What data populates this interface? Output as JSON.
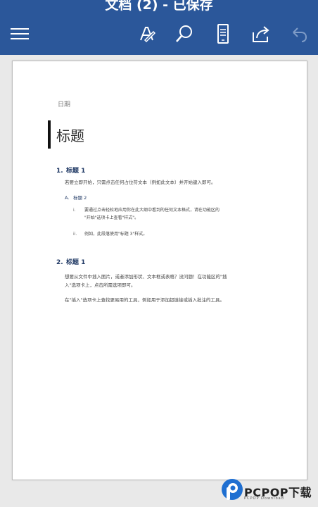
{
  "window": {
    "title": "文档 (2) - 已保存"
  },
  "toolbar": {
    "menu": "hamburger-icon",
    "edit": "pen-icon",
    "search": "search-icon",
    "view": "mobile-view-icon",
    "share": "share-icon",
    "undo": "undo-icon",
    "undo_disabled": true
  },
  "colors": {
    "brand": "#2b579a",
    "heading": "#1f3864"
  },
  "document": {
    "date": "日期",
    "title": "标题",
    "section1": {
      "num": "1.",
      "heading": "标题 1",
      "body": "若要立即开始，只需点击任何占位符文本（例如此文本）并开始键入即可。",
      "sub": {
        "num": "A.",
        "heading": "标题 2",
        "items": [
          {
            "num": "i.",
            "line1": "要通过点击轻松地应用你在此大纲中看到的任何文本格式，请在功能区的",
            "line2": "\"开始\"选项卡上查看\"样式\"。"
          },
          {
            "num": "ii.",
            "line1": "例如，此段落使用\"标题 3\"样式。",
            "line2": ""
          }
        ]
      }
    },
    "section2": {
      "num": "2.",
      "heading": "标题 1",
      "para1_line1": "想要从文件中插入图片，或者添加形状、文本框或表格？没问题！在功能区的\"插",
      "para1_line2": "入\"选项卡上，点击所需选项即可。",
      "para2": "在\"插入\"选项卡上查找更易用的工具，例如用于添加超链接或插入批注的工具。"
    }
  },
  "watermark": {
    "brand": "PCPOP下载",
    "sub": "PCPOP Download",
    "logo": "pcpop-logo"
  }
}
